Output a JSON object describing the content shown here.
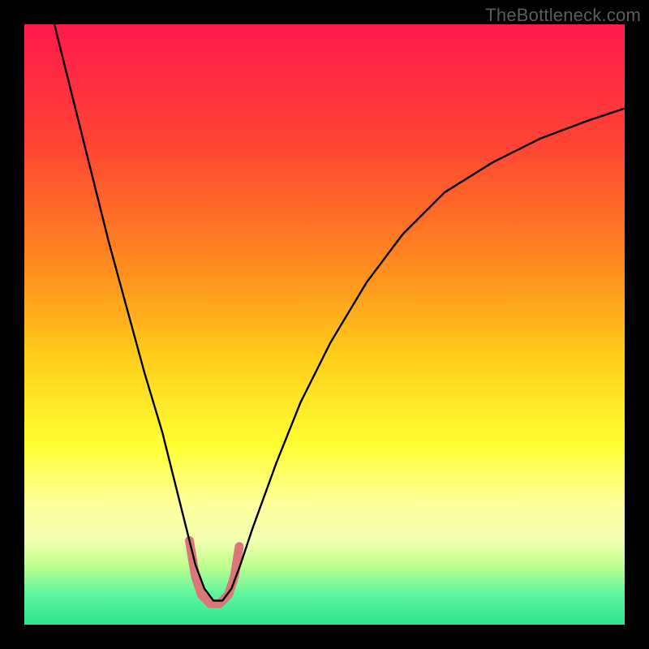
{
  "watermark": {
    "text": "TheBottleneck.com"
  },
  "chart_data": {
    "type": "line",
    "title": "",
    "xlabel": "",
    "ylabel": "",
    "xlim": [
      0,
      100
    ],
    "ylim": [
      0,
      100
    ],
    "grid": false,
    "legend": false,
    "background": {
      "type": "vertical-gradient",
      "stops": [
        {
          "offset": 0.0,
          "color": "#ff1a4d"
        },
        {
          "offset": 0.2,
          "color": "#ff4433"
        },
        {
          "offset": 0.4,
          "color": "#ff8a1f"
        },
        {
          "offset": 0.55,
          "color": "#ffcc1a"
        },
        {
          "offset": 0.7,
          "color": "#ffff33"
        },
        {
          "offset": 0.8,
          "color": "#ffff9e"
        },
        {
          "offset": 0.86,
          "color": "#f2ffb0"
        },
        {
          "offset": 0.9,
          "color": "#c2ff8f"
        },
        {
          "offset": 0.95,
          "color": "#5ef59d"
        },
        {
          "offset": 1.0,
          "color": "#2de58e"
        }
      ]
    },
    "series": [
      {
        "name": "bottleneck-curve",
        "color": "#000000",
        "stroke_width": 2.4,
        "x": [
          5,
          8,
          11,
          14,
          17,
          20,
          23,
          25,
          27,
          28.5,
          30,
          31.5,
          33,
          34.5,
          36,
          38,
          42,
          46,
          51,
          57,
          63,
          70,
          78,
          86,
          94,
          100
        ],
        "y": [
          100,
          88,
          76,
          64,
          53,
          42,
          32,
          24,
          16,
          10,
          6,
          4,
          4,
          6,
          10,
          16,
          27,
          37,
          47,
          57,
          65,
          72,
          77,
          81,
          84,
          86
        ]
      }
    ],
    "markers": [
      {
        "name": "highlighted-range",
        "color": "#d97878",
        "stroke_width": 11,
        "linecap": "round",
        "points": [
          {
            "x": 27.5,
            "y": 14
          },
          {
            "x": 28.5,
            "y": 8
          },
          {
            "x": 29.5,
            "y": 5
          },
          {
            "x": 31.0,
            "y": 3.5
          },
          {
            "x": 32.5,
            "y": 3.5
          },
          {
            "x": 34.0,
            "y": 5
          },
          {
            "x": 35.0,
            "y": 8
          },
          {
            "x": 35.8,
            "y": 13
          }
        ]
      }
    ]
  }
}
